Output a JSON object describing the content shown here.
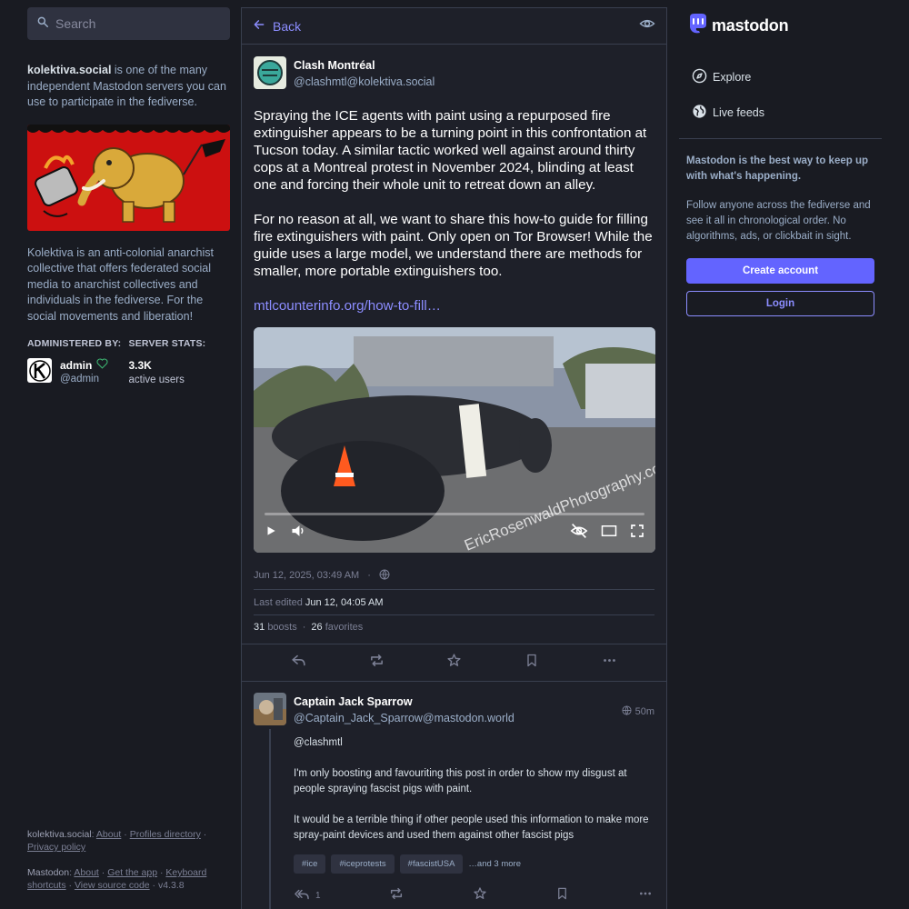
{
  "search": {
    "placeholder": "Search"
  },
  "server_intro": {
    "domain": "kolektiva.social",
    "text": " is one of the many independent Mastodon servers you can use to participate in the fediverse."
  },
  "about": "Kolektiva is an anti-colonial anarchist collective that offers federated social media to anarchist collectives and individuals in the fediverse. For the social movements and liberation!",
  "administered_by": {
    "heading": "ADMINISTERED BY:",
    "name": "admin",
    "handle": "@admin"
  },
  "server_stats": {
    "heading": "SERVER STATS:",
    "active_users": "3.3K",
    "label": "active users"
  },
  "footer": {
    "server": "kolektiva.social",
    "server_links": [
      "About",
      "Profiles directory",
      "Privacy policy"
    ],
    "mastodon": "Mastodon",
    "mastodon_links": [
      "About",
      "Get the app",
      "Keyboard shortcuts",
      "View source code"
    ],
    "version": "v4.3.8"
  },
  "column_header": {
    "back_label": "Back"
  },
  "status": {
    "display_name": "Clash Montréal",
    "handle": "@clashmtl@kolektiva.social",
    "paragraph1": "Spraying the ICE agents with paint using a repurposed fire extinguisher appears to be a turning point in this confrontation at Tucson today. A similar tactic worked well against around thirty cops at a Montreal protest in November 2024, blinding at least one and forcing their whole unit to retreat down an alley.",
    "paragraph2": "For no reason at all, we want to share this how-to guide for filling fire extinguishers with paint. Only open on Tor Browser! While the guide uses a large model, we understand there are methods for smaller, more portable extinguishers too.",
    "link_text": "mtlcounterinfo.org/how-to-fill…",
    "video_watermark": "EricRosenwaldPhotography.com",
    "video_progress": 0,
    "timestamp": "Jun 12, 2025, 03:49 AM",
    "edited_label": "Last edited",
    "edited_value": "Jun 12, 04:05 AM",
    "boosts_count": "31",
    "boosts_label": "boosts",
    "favorites_count": "26",
    "favorites_label": "favorites"
  },
  "reply": {
    "display_name": "Captain Jack Sparrow",
    "handle": "@Captain_Jack_Sparrow@mastodon.world",
    "time": "50m",
    "mention": "@clashmtl",
    "paragraph1": "I'm only boosting and favouriting this post in order to show my disgust at people spraying fascist pigs with paint.",
    "paragraph2": "It would be a terrible thing if other people used this information to make more spray-paint devices and used them against other fascist pigs",
    "hashtags": [
      "#ice",
      "#iceprotests",
      "#fascistUSA"
    ],
    "more_tags": "…and 3 more",
    "reply_count": "1"
  },
  "right": {
    "logo_text": "mastodon",
    "nav": [
      {
        "label": "Explore",
        "icon": "compass-icon"
      },
      {
        "label": "Live feeds",
        "icon": "globe-icon"
      }
    ],
    "promo_heading": "Mastodon is the best way to keep up with what's happening.",
    "promo_text": "Follow anyone across the fediverse and see it all in chronological order. No algorithms, ads, or clickbait in sight.",
    "create_account": "Create account",
    "login": "Login"
  },
  "colors": {
    "background": "#191b22",
    "panel": "#1e2029",
    "accent": "#6364ff",
    "link": "#8c8dff",
    "hero_red": "#cc1010"
  }
}
